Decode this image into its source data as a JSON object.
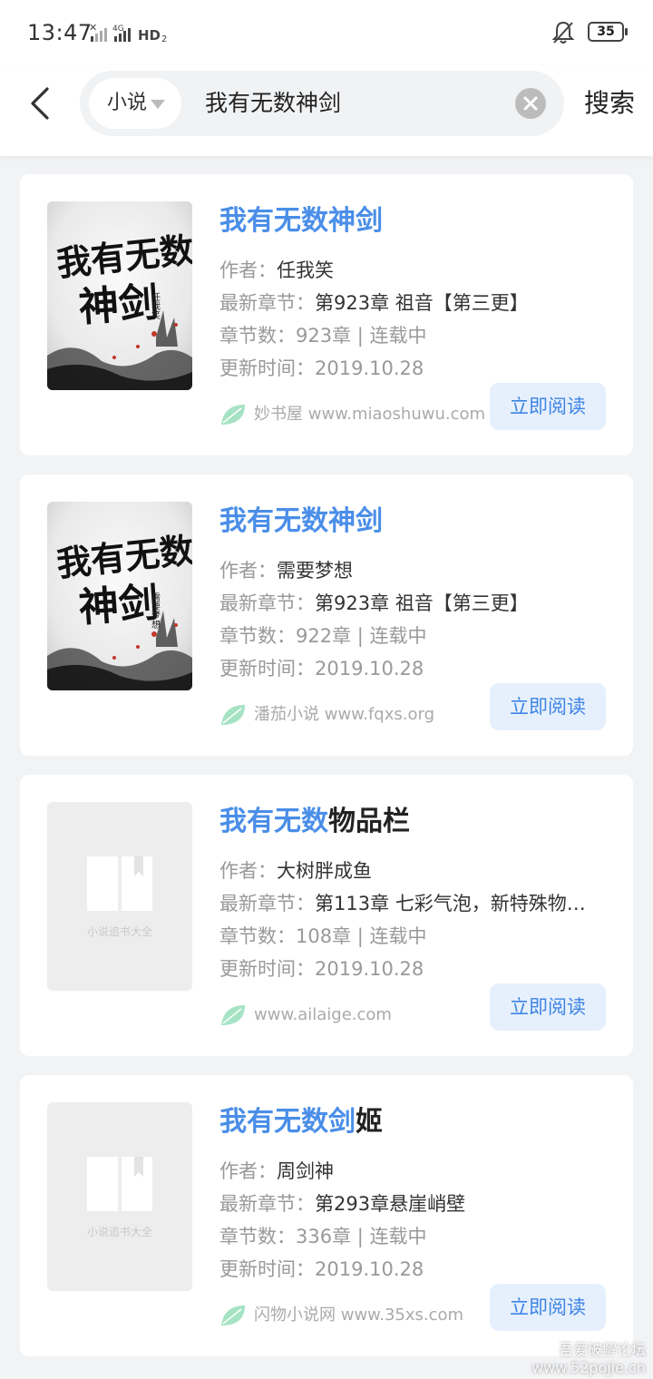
{
  "status": {
    "time": "13:47",
    "network": "4G",
    "hd": "HD2",
    "battery": "35"
  },
  "search": {
    "category": "小说",
    "query": "我有无数神剑",
    "button_label": "搜索"
  },
  "results": [
    {
      "title_highlight": "我有无数神剑",
      "title_rest": "",
      "author_label": "作者：",
      "author": "任我笑",
      "latest_label": "最新章节：",
      "latest": "第923章 祖音【第三更】",
      "count_label": "章节数：",
      "count": "923章 | 连载中",
      "update_label": "更新时间：",
      "update": "2019.10.28",
      "source": "妙书屋 www.miaoshuwu.com",
      "read_label": "立即阅读",
      "cover_title": "我有无数神剑",
      "cover_author": "任我笑"
    },
    {
      "title_highlight": "我有无数神剑",
      "title_rest": "",
      "author_label": "作者：",
      "author": "需要梦想",
      "latest_label": "最新章节：",
      "latest": "第923章 祖音【第三更】",
      "count_label": "章节数：",
      "count": "922章 | 连载中",
      "update_label": "更新时间：",
      "update": "2019.10.28",
      "source": "潘茄小说 www.fqxs.org",
      "read_label": "立即阅读",
      "cover_title": "我有无数神剑",
      "cover_author": "需要梦想"
    },
    {
      "title_highlight": "我有无数",
      "title_rest": "物品栏",
      "author_label": "作者：",
      "author": "大树胖成鱼",
      "latest_label": "最新章节：",
      "latest": "第113章 七彩气泡，新特殊物…",
      "count_label": "章节数：",
      "count": "108章 | 连载中",
      "update_label": "更新时间：",
      "update": "2019.10.28",
      "source": "www.ailaige.com",
      "read_label": "立即阅读",
      "placeholder_text": "小说追书大全"
    },
    {
      "title_highlight": "我有无数剑",
      "title_rest": "姬",
      "author_label": "作者：",
      "author": "周剑神",
      "latest_label": "最新章节：",
      "latest": "第293章悬崖峭壁",
      "count_label": "章节数：",
      "count": "336章 | 连载中",
      "update_label": "更新时间：",
      "update": "2019.10.28",
      "source": "闪物小说网 www.35xs.com",
      "read_label": "立即阅读",
      "placeholder_text": "小说追书大全"
    }
  ],
  "watermark": {
    "line1": "吾爱破解论坛",
    "line2": "www.52pojie.cn"
  },
  "colors": {
    "accent": "#4a8ee8",
    "button_bg": "#e6f0fd",
    "leaf": "#a6e3c4"
  }
}
